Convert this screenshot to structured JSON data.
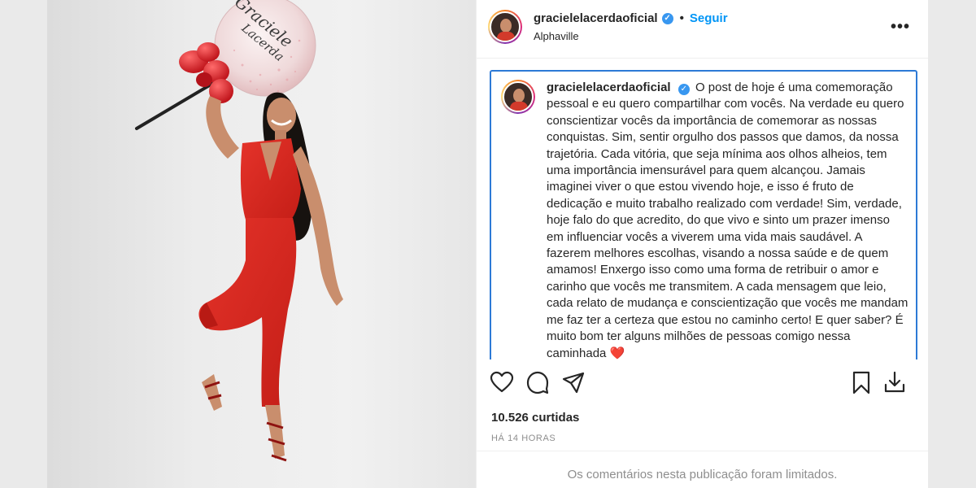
{
  "post": {
    "username": "gracielelacerdaoficial",
    "verified_icon": "verified-badge-icon",
    "follow_label": "Seguir",
    "separator": "•",
    "location": "Alphaville",
    "more_label": "•••"
  },
  "caption": {
    "username": "gracielelacerdaoficial",
    "text": "O post de hoje é uma comemoração pessoal e eu quero compartilhar com vocês. Na verdade eu quero conscientizar vocês da importância de comemorar as nossas conquistas. Sim, sentir orgulho dos passos que damos, da nossa trajetória. Cada vitória, que seja mínima aos olhos alheios, tem uma importância imensurável para quem alcançou. Jamais imaginei viver o que estou vivendo hoje, e isso é fruto de dedicação e muito trabalho realizado com verdade! Sim, verdade, hoje falo do que acredito, do que vivo e sinto um prazer imenso em influenciar vocês a viverem uma vida mais saudável. A fazerem melhores escolhas, visando a nossa saúde e de quem amamos! Enxergo isso como uma forma de retribuir o amor e carinho que vocês me transmitem. A cada mensagem que leio, cada relato de mudança e conscientização que vocês me mandam me faz ter a certeza que estou no caminho certo! E quer saber? É muito bom ter alguns milhões de pessoas comigo nessa caminhada",
    "emoji": "❤️"
  },
  "balloon_text": [
    "Graciele",
    "Lacerda"
  ],
  "actions": {
    "icons": [
      "heart-icon",
      "comment-icon",
      "share-icon",
      "bookmark-icon",
      "download-icon"
    ]
  },
  "likes": "10.526 curtidas",
  "timestamp": "HÁ 14 HORAS",
  "comments_limited": "Os comentários nesta publicação foram limitados.",
  "colors": {
    "follow_blue": "#0095f6",
    "verified_blue": "#3897f0",
    "focus_border": "#2d7ad6",
    "jumpsuit_red": "#d9271d"
  }
}
